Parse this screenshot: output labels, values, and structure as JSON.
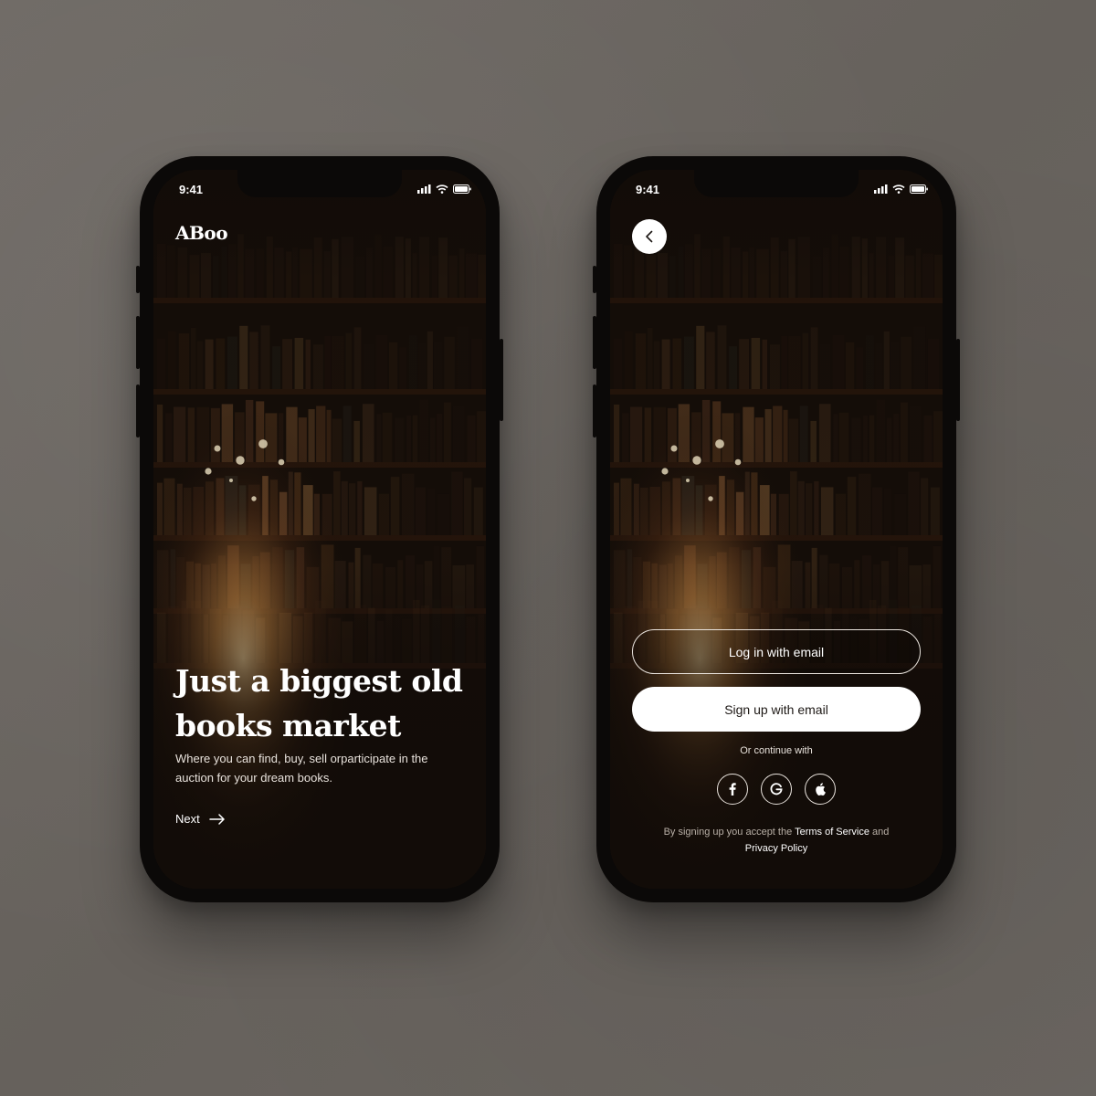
{
  "status": {
    "time": "9:41"
  },
  "onboarding": {
    "logo": "ABoo",
    "headline": "Just a biggest old books market",
    "subtitle": "Where you can find, buy, sell orparticipate in the auction for your dream books.",
    "next_label": "Next"
  },
  "auth": {
    "login_label": "Log in with email",
    "signup_label": "Sign up with email",
    "or_text": "Or continue with",
    "socials": [
      "facebook-icon",
      "google-icon",
      "apple-icon"
    ],
    "terms_prefix": "By signing up you accept the ",
    "terms_link": "Terms of Service",
    "terms_and": " and ",
    "privacy_link": "Privacy Policy"
  },
  "colors": {
    "background": "#6b6661",
    "phone_frame": "#0b0908",
    "screen_dark": "#120c08",
    "accent_light": "#ffffff"
  }
}
